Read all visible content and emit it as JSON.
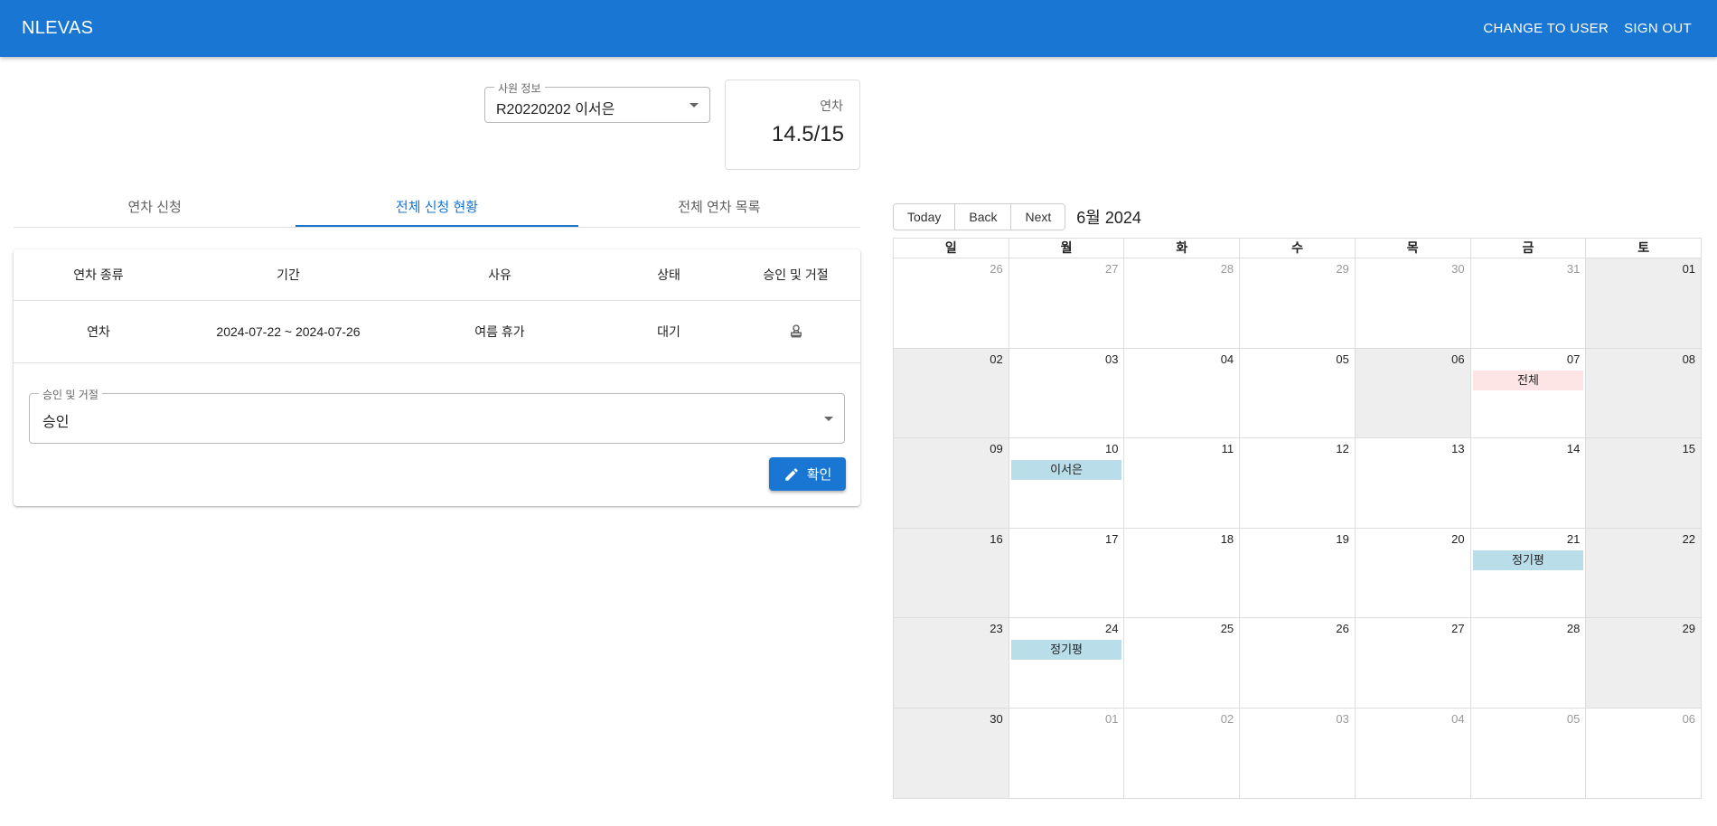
{
  "app": {
    "brand": "NLEVAS",
    "nav": [
      "CHANGE TO USER",
      "SIGN OUT"
    ]
  },
  "employee_select": {
    "label": "사원 정보",
    "value": "R20220202 이서은"
  },
  "leave_card": {
    "label": "연차",
    "value": "14.5/15"
  },
  "tabs": [
    {
      "label": "연차 신청",
      "active": false
    },
    {
      "label": "전체 신청 현황",
      "active": true
    },
    {
      "label": "전체 연차 목록",
      "active": false
    }
  ],
  "table": {
    "headers": [
      "연차 종류",
      "기간",
      "사유",
      "상태",
      "승인 및 거절"
    ],
    "rows": [
      {
        "type": "연차",
        "period": "2024-07-22 ~ 2024-07-26",
        "reason": "여름 휴가",
        "status": "대기",
        "action_icon": "stamp-icon"
      }
    ]
  },
  "approval_select": {
    "label": "승인 및 거절",
    "value": "승인"
  },
  "confirm_button": {
    "label": "확인",
    "icon": "pencil-icon"
  },
  "calendar": {
    "toolbar_buttons": [
      "Today",
      "Back",
      "Next"
    ],
    "label": "6월 2024",
    "weekdays": [
      "일",
      "월",
      "화",
      "수",
      "목",
      "금",
      "토"
    ],
    "colors": {
      "event_blue": "#b9dde9",
      "event_pink": "#fde5e5",
      "off_day": "#eeeeee"
    },
    "weeks": [
      [
        {
          "d": "26",
          "other": true,
          "off": false
        },
        {
          "d": "27",
          "other": true,
          "off": false
        },
        {
          "d": "28",
          "other": true,
          "off": false
        },
        {
          "d": "29",
          "other": true,
          "off": false
        },
        {
          "d": "30",
          "other": true,
          "off": false
        },
        {
          "d": "31",
          "other": true,
          "off": false
        },
        {
          "d": "01",
          "other": false,
          "off": true
        }
      ],
      [
        {
          "d": "02",
          "other": false,
          "off": true
        },
        {
          "d": "03",
          "other": false,
          "off": false
        },
        {
          "d": "04",
          "other": false,
          "off": false
        },
        {
          "d": "05",
          "other": false,
          "off": false
        },
        {
          "d": "06",
          "other": false,
          "off": true
        },
        {
          "d": "07",
          "other": false,
          "off": false,
          "event": {
            "label": "전체",
            "color": "pink"
          }
        },
        {
          "d": "08",
          "other": false,
          "off": true
        }
      ],
      [
        {
          "d": "09",
          "other": false,
          "off": true
        },
        {
          "d": "10",
          "other": false,
          "off": false,
          "event": {
            "label": "이서은",
            "color": "blue"
          }
        },
        {
          "d": "11",
          "other": false,
          "off": false
        },
        {
          "d": "12",
          "other": false,
          "off": false
        },
        {
          "d": "13",
          "other": false,
          "off": false
        },
        {
          "d": "14",
          "other": false,
          "off": false
        },
        {
          "d": "15",
          "other": false,
          "off": true
        }
      ],
      [
        {
          "d": "16",
          "other": false,
          "off": true
        },
        {
          "d": "17",
          "other": false,
          "off": false
        },
        {
          "d": "18",
          "other": false,
          "off": false
        },
        {
          "d": "19",
          "other": false,
          "off": false
        },
        {
          "d": "20",
          "other": false,
          "off": false
        },
        {
          "d": "21",
          "other": false,
          "off": false,
          "event": {
            "label": "정기평",
            "color": "blue"
          }
        },
        {
          "d": "22",
          "other": false,
          "off": true
        }
      ],
      [
        {
          "d": "23",
          "other": false,
          "off": true
        },
        {
          "d": "24",
          "other": false,
          "off": false,
          "event": {
            "label": "정기평",
            "color": "blue"
          }
        },
        {
          "d": "25",
          "other": false,
          "off": false
        },
        {
          "d": "26",
          "other": false,
          "off": false
        },
        {
          "d": "27",
          "other": false,
          "off": false
        },
        {
          "d": "28",
          "other": false,
          "off": false
        },
        {
          "d": "29",
          "other": false,
          "off": true
        }
      ],
      [
        {
          "d": "30",
          "other": false,
          "off": true
        },
        {
          "d": "01",
          "other": true,
          "off": false
        },
        {
          "d": "02",
          "other": true,
          "off": false
        },
        {
          "d": "03",
          "other": true,
          "off": false
        },
        {
          "d": "04",
          "other": true,
          "off": false
        },
        {
          "d": "05",
          "other": true,
          "off": false
        },
        {
          "d": "06",
          "other": true,
          "off": false
        }
      ]
    ]
  }
}
